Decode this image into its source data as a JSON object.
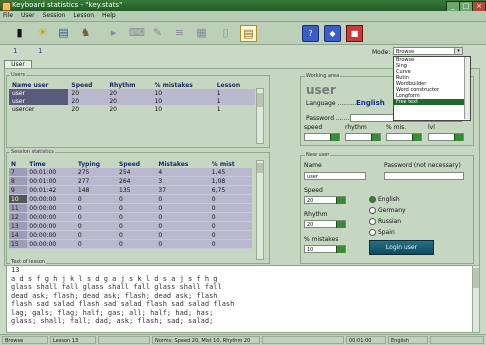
{
  "window": {
    "title": "Keyboard statistics - \"key.stats\""
  },
  "menu": [
    "File",
    "User",
    "Session",
    "Lesson",
    "Help"
  ],
  "toolbar": {
    "icons": [
      "bars-icon",
      "run-icon",
      "stats-icon",
      "walker-icon",
      "play-icon",
      "keys-icon",
      "lesson-icon",
      "levels-icon",
      "grid-icon",
      "notes-icon",
      "help-icon",
      "info-icon",
      "stop-icon"
    ],
    "levels": [
      "1",
      "1"
    ]
  },
  "mode": {
    "label": "Mode:",
    "selected": "Browse",
    "options": [
      "Browse",
      "Sing",
      "Curve",
      "Rutin",
      "Wordbuilder",
      "Word constructor",
      "Longform",
      "Free text"
    ],
    "highlighted_index": 7
  },
  "tab": {
    "label": "User"
  },
  "users": {
    "title": "Users",
    "headers": [
      "Name user",
      "Speed",
      "Rhythm",
      "% mistakes",
      "Lesson"
    ],
    "rows": [
      [
        "user",
        "20",
        "20",
        "10",
        "1"
      ],
      [
        "user",
        "20",
        "20",
        "10",
        "1"
      ],
      [
        "usercer",
        "20",
        "20",
        "10",
        "1"
      ]
    ]
  },
  "working_area": {
    "title": "Working area",
    "user_heading": "user",
    "language_label": "Language ............",
    "language_value": "English",
    "password_label": "Password ...............",
    "fields": [
      "speed",
      "rhythm",
      "% mis.",
      "lvl"
    ]
  },
  "session_stats": {
    "title": "Session statistics",
    "headers": [
      "N",
      "Time",
      "Typing",
      "Speed",
      "Mistakes",
      "% mist"
    ],
    "rows": [
      [
        "7",
        "00:01:00",
        "275",
        "254",
        "4",
        "1,45"
      ],
      [
        "8",
        "00:01:00",
        "277",
        "264",
        "3",
        "1,08"
      ],
      [
        "9",
        "00:01:42",
        "148",
        "135",
        "37",
        "6,75"
      ],
      [
        "10",
        "00:00:00",
        "0",
        "0",
        "0",
        "0"
      ],
      [
        "11",
        "00:00:00",
        "0",
        "0",
        "0",
        "0"
      ],
      [
        "12",
        "00:00:00",
        "0",
        "0",
        "0",
        "0"
      ],
      [
        "13",
        "00:00:00",
        "0",
        "0",
        "0",
        "0"
      ],
      [
        "14",
        "00:00:00",
        "0",
        "0",
        "0",
        "0"
      ],
      [
        "15",
        "00:00:00",
        "0",
        "0",
        "0",
        "0"
      ]
    ]
  },
  "new_user": {
    "title": "New user",
    "name_label": "Name",
    "name_value": "user",
    "password_label": "Password (not necessary)",
    "speed_label": "Speed",
    "speed_value": "20",
    "rhythm_label": "Rhythm",
    "rhythm_value": "20",
    "mistakes_label": "% mistakes",
    "mistakes_value": "10",
    "languages": [
      "English",
      "Germany",
      "Russian",
      "Spain"
    ],
    "selected_language": "English",
    "login_button": "Login user"
  },
  "lesson": {
    "title": "Text of lesson",
    "lines": [
      "13",
      "a d s f g h j k l s d g a j s k l d s a j s f h g",
      "glass shall fall glass shall fall glass shall fall",
      "dead ask; flash; dead ask; flash; dead ask; flash",
      "flash sad salad flash sad salad flash sad salad flash",
      "lag; gals; flag; half; gas; all; half; had; has;",
      "glass; shall; fall; dad; ask; flash; sad; salad;"
    ]
  },
  "status": {
    "mode": "Browse",
    "lesson": "Lesson 13",
    "norms": "Norms: Speed 20, Mist 10, Rhythm 20",
    "time": "00:01:00",
    "language": "English"
  },
  "colors": {
    "accent": "#1e6a2a",
    "selection": "#b9b8cf",
    "button": "#1a5a6c"
  }
}
